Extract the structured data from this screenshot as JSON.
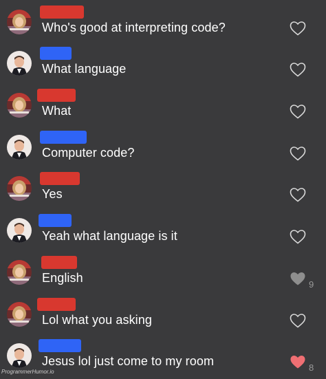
{
  "colors": {
    "background": "#3a3a3c",
    "text": "#ffffff",
    "heart_outline": "#d9d9d9",
    "heart_liked_gray": "#8e8e8e",
    "heart_liked_red": "#ef6f73",
    "redaction_red": "#d8382f",
    "redaction_blue": "#2f64f6"
  },
  "comments": [
    {
      "avatar": "girl-avatar",
      "redaction_color": "red",
      "text": "Who's good at interpreting code?",
      "heart": "outline",
      "likes": ""
    },
    {
      "avatar": "boy-avatar",
      "redaction_color": "blue",
      "text": "What language",
      "heart": "outline",
      "likes": ""
    },
    {
      "avatar": "girl-avatar",
      "redaction_color": "red",
      "text": "What",
      "heart": "outline",
      "likes": ""
    },
    {
      "avatar": "boy-avatar",
      "redaction_color": "blue",
      "text": "Computer code?",
      "heart": "outline",
      "likes": ""
    },
    {
      "avatar": "girl-avatar",
      "redaction_color": "red",
      "text": "Yes",
      "heart": "outline",
      "likes": ""
    },
    {
      "avatar": "boy-avatar",
      "redaction_color": "blue",
      "text": "Yeah what language is it",
      "heart": "outline",
      "likes": ""
    },
    {
      "avatar": "girl-avatar",
      "redaction_color": "red",
      "text": "English",
      "heart": "filled-gray",
      "likes": "9"
    },
    {
      "avatar": "girl-avatar",
      "redaction_color": "red",
      "text": "Lol what you asking",
      "heart": "outline",
      "likes": ""
    },
    {
      "avatar": "boy-avatar",
      "redaction_color": "blue",
      "text": "Jesus lol just come to my room",
      "heart": "filled-red",
      "likes": "8"
    }
  ],
  "watermark": "ProgrammerHumor.io"
}
